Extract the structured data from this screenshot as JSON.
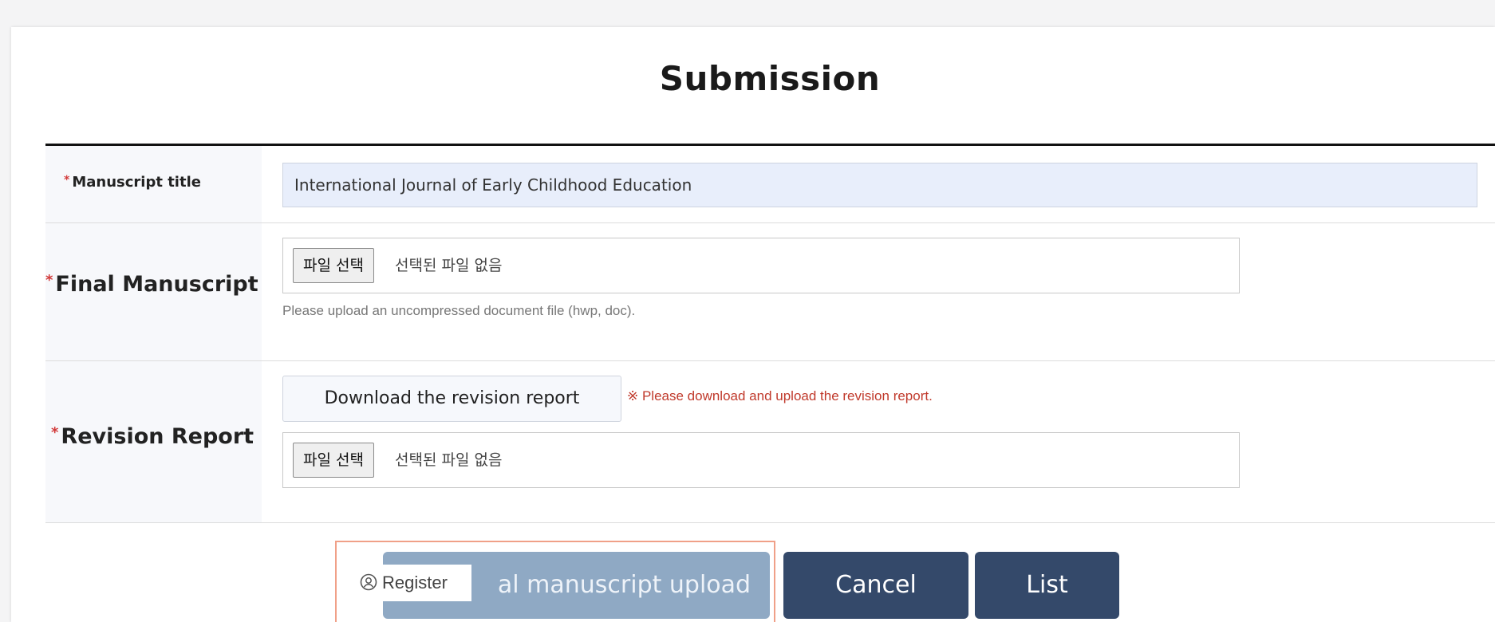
{
  "page": {
    "title": "Submission"
  },
  "form": {
    "manuscript_title": {
      "label": "Manuscript title",
      "value": "International Journal of Early Childhood Education"
    },
    "final_manuscript": {
      "label": "Final Manuscript",
      "choose_file_label": "파일 선택",
      "file_status": "선택된 파일 없음",
      "hint": "Please upload an uncompressed document file (hwp, doc)."
    },
    "revision_report": {
      "label": "Revision Report",
      "download_label": "Download the revision report",
      "warning": "※ Please download and upload the revision report.",
      "choose_file_label": "파일 선택",
      "file_status": "선택된 파일 없음"
    },
    "required_mark": "*"
  },
  "actions": {
    "upload_label": "al manuscript upload",
    "cancel_label": "Cancel",
    "list_label": "List",
    "register_tooltip": "Register"
  },
  "colors": {
    "primary_button": "#34496a",
    "upload_button": "#8fa9c4",
    "required_star": "#d23a3a",
    "warning_text": "#c0392b",
    "highlight_frame": "#f0a088",
    "title_input_bg": "#e8eefb"
  },
  "icons": {
    "register": "user-circle-icon"
  }
}
